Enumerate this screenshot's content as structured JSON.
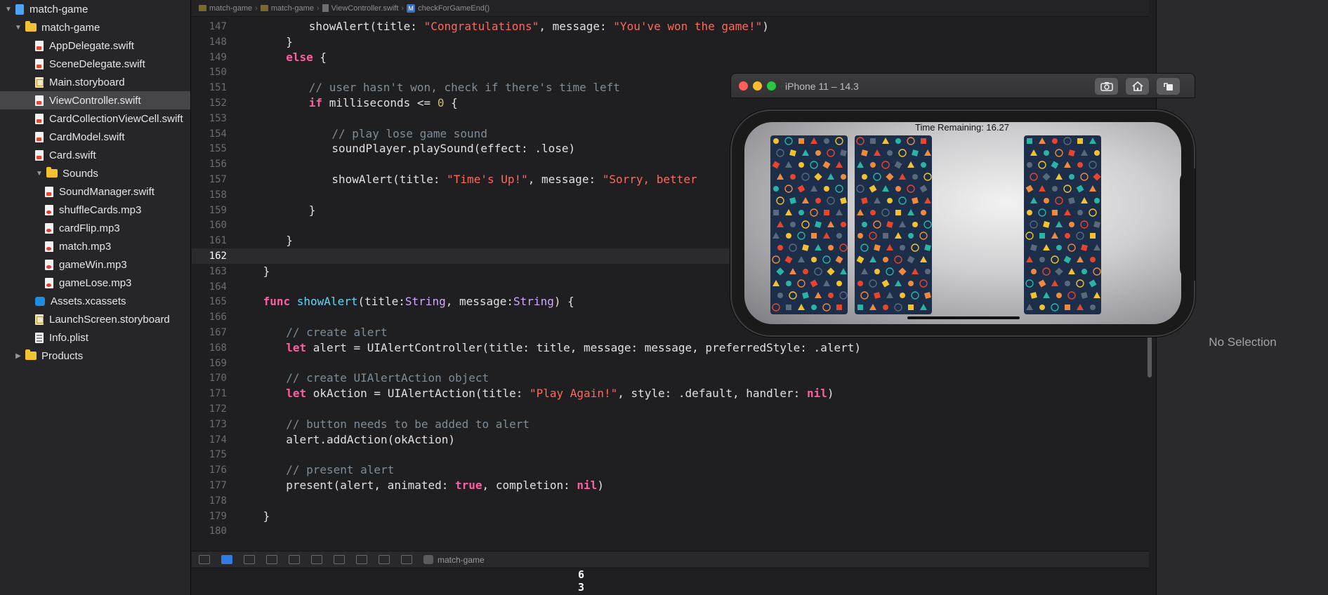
{
  "navigator": {
    "items": [
      {
        "label": "match-game",
        "level": 0,
        "kind": "project",
        "disclosure": "expanded"
      },
      {
        "label": "match-game",
        "level": 1,
        "kind": "folder",
        "disclosure": "expanded"
      },
      {
        "label": "AppDelegate.swift",
        "level": 2,
        "kind": "swift"
      },
      {
        "label": "SceneDelegate.swift",
        "level": 2,
        "kind": "swift"
      },
      {
        "label": "Main.storyboard",
        "level": 2,
        "kind": "storyboard"
      },
      {
        "label": "ViewController.swift",
        "level": 2,
        "kind": "swift",
        "selected": true
      },
      {
        "label": "CardCollectionViewCell.swift",
        "level": 2,
        "kind": "swift"
      },
      {
        "label": "CardModel.swift",
        "level": 2,
        "kind": "swift"
      },
      {
        "label": "Card.swift",
        "level": 2,
        "kind": "swift"
      },
      {
        "label": "Sounds",
        "level": 2,
        "kind": "folder",
        "disclosure": "expanded"
      },
      {
        "label": "SoundManager.swift",
        "level": 3,
        "kind": "swift"
      },
      {
        "label": "shuffleCards.mp3",
        "level": 3,
        "kind": "mp3"
      },
      {
        "label": "cardFlip.mp3",
        "level": 3,
        "kind": "mp3"
      },
      {
        "label": "match.mp3",
        "level": 3,
        "kind": "mp3"
      },
      {
        "label": "gameWin.mp3",
        "level": 3,
        "kind": "mp3"
      },
      {
        "label": "gameLose.mp3",
        "level": 3,
        "kind": "mp3"
      },
      {
        "label": "Assets.xcassets",
        "level": 2,
        "kind": "assets"
      },
      {
        "label": "LaunchScreen.storyboard",
        "level": 2,
        "kind": "storyboard"
      },
      {
        "label": "Info.plist",
        "level": 2,
        "kind": "plist"
      },
      {
        "label": "Products",
        "level": 1,
        "kind": "folder",
        "disclosure": "collapsed"
      }
    ]
  },
  "jumpbar": {
    "crumbs": [
      "match-game",
      "match-game",
      "ViewController.swift",
      "checkForGameEnd()"
    ]
  },
  "editor": {
    "current_line": 162,
    "lines": [
      {
        "n": "147",
        "indent": 3,
        "tokens": [
          [
            "",
            "showAlert(title: "
          ],
          [
            "str",
            "\"Congratulations\""
          ],
          [
            "",
            ", message: "
          ],
          [
            "str",
            "\"You've won the game!\""
          ],
          [
            "",
            ")"
          ]
        ]
      },
      {
        "n": "148",
        "indent": 2,
        "tokens": [
          [
            "",
            "}"
          ]
        ]
      },
      {
        "n": "149",
        "indent": 2,
        "tokens": [
          [
            "kw",
            "else"
          ],
          [
            "",
            " {"
          ]
        ]
      },
      {
        "n": "150",
        "indent": 0,
        "tokens": []
      },
      {
        "n": "151",
        "indent": 3,
        "tokens": [
          [
            "cm",
            "// user hasn't won, check if there's time left"
          ]
        ]
      },
      {
        "n": "152",
        "indent": 3,
        "tokens": [
          [
            "kw",
            "if"
          ],
          [
            "",
            " milliseconds <= "
          ],
          [
            "num",
            "0"
          ],
          [
            "",
            " {"
          ]
        ]
      },
      {
        "n": "153",
        "indent": 0,
        "tokens": []
      },
      {
        "n": "154",
        "indent": 4,
        "tokens": [
          [
            "cm",
            "// play lose game sound"
          ]
        ]
      },
      {
        "n": "155",
        "indent": 4,
        "tokens": [
          [
            "",
            "soundPlayer.playSound(effect: .lose)"
          ]
        ]
      },
      {
        "n": "156",
        "indent": 0,
        "tokens": []
      },
      {
        "n": "157",
        "indent": 4,
        "tokens": [
          [
            "",
            "showAlert(title: "
          ],
          [
            "str",
            "\"Time's Up!\""
          ],
          [
            "",
            ", message: "
          ],
          [
            "str",
            "\"Sorry, better"
          ]
        ]
      },
      {
        "n": "158",
        "indent": 0,
        "tokens": []
      },
      {
        "n": "159",
        "indent": 3,
        "tokens": [
          [
            "",
            "}"
          ]
        ]
      },
      {
        "n": "160",
        "indent": 0,
        "tokens": []
      },
      {
        "n": "161",
        "indent": 2,
        "tokens": [
          [
            "",
            "}"
          ]
        ]
      },
      {
        "n": "162",
        "indent": 0,
        "tokens": []
      },
      {
        "n": "163",
        "indent": 1,
        "tokens": [
          [
            "",
            "}"
          ]
        ]
      },
      {
        "n": "164",
        "indent": 0,
        "tokens": []
      },
      {
        "n": "165",
        "indent": 1,
        "tokens": [
          [
            "kw",
            "func"
          ],
          [
            "",
            " "
          ],
          [
            "fn",
            "showAlert"
          ],
          [
            "",
            "(title:"
          ],
          [
            "ty",
            "String"
          ],
          [
            "",
            ", message:"
          ],
          [
            "ty",
            "String"
          ],
          [
            "",
            ") {"
          ]
        ]
      },
      {
        "n": "166",
        "indent": 0,
        "tokens": []
      },
      {
        "n": "167",
        "indent": 2,
        "tokens": [
          [
            "cm",
            "// create alert"
          ]
        ]
      },
      {
        "n": "168",
        "indent": 2,
        "tokens": [
          [
            "kw",
            "let"
          ],
          [
            "",
            " alert = UIAlertController(title: title, message: message, preferredStyle: .alert)"
          ]
        ]
      },
      {
        "n": "169",
        "indent": 0,
        "tokens": []
      },
      {
        "n": "170",
        "indent": 2,
        "tokens": [
          [
            "cm",
            "// create UIAlertAction object"
          ]
        ]
      },
      {
        "n": "171",
        "indent": 2,
        "tokens": [
          [
            "kw",
            "let"
          ],
          [
            "",
            " okAction = UIAlertAction(title: "
          ],
          [
            "str",
            "\"Play Again!\""
          ],
          [
            "",
            ", style: .default, handler: "
          ],
          [
            "kw",
            "nil"
          ],
          [
            "",
            ")"
          ]
        ]
      },
      {
        "n": "172",
        "indent": 0,
        "tokens": []
      },
      {
        "n": "173",
        "indent": 2,
        "tokens": [
          [
            "cm",
            "// button needs to be added to alert"
          ]
        ]
      },
      {
        "n": "174",
        "indent": 2,
        "tokens": [
          [
            "",
            "alert.addAction(okAction)"
          ]
        ]
      },
      {
        "n": "175",
        "indent": 0,
        "tokens": []
      },
      {
        "n": "176",
        "indent": 2,
        "tokens": [
          [
            "cm",
            "// present alert"
          ]
        ]
      },
      {
        "n": "177",
        "indent": 2,
        "tokens": [
          [
            "",
            "present(alert, animated: "
          ],
          [
            "kw",
            "true"
          ],
          [
            "",
            ", completion: "
          ],
          [
            "kw",
            "nil"
          ],
          [
            "",
            ")"
          ]
        ]
      },
      {
        "n": "178",
        "indent": 0,
        "tokens": []
      },
      {
        "n": "179",
        "indent": 1,
        "tokens": [
          [
            "",
            "}"
          ]
        ]
      },
      {
        "n": "180",
        "indent": 0,
        "tokens": []
      }
    ]
  },
  "debugbar": {
    "scheme": "match-game"
  },
  "console": {
    "lines": [
      "6",
      "3"
    ]
  },
  "inspector": {
    "empty_text": "No Selection"
  },
  "simulator": {
    "title": "iPhone 11 – 14.3",
    "buttons": [
      "screenshot-icon",
      "home-icon",
      "rotate-icon"
    ],
    "time_label": "Time Remaining: 16.27",
    "traffic_lights": {
      "close": "#fe5f57",
      "minimize": "#febc2e",
      "zoom": "#28c840"
    }
  },
  "colors": {
    "keyword": "#fc5fa3",
    "string": "#fc6a5d",
    "comment": "#7f8c98",
    "number": "#d0bf69",
    "card_back": "#1c2e4a"
  }
}
